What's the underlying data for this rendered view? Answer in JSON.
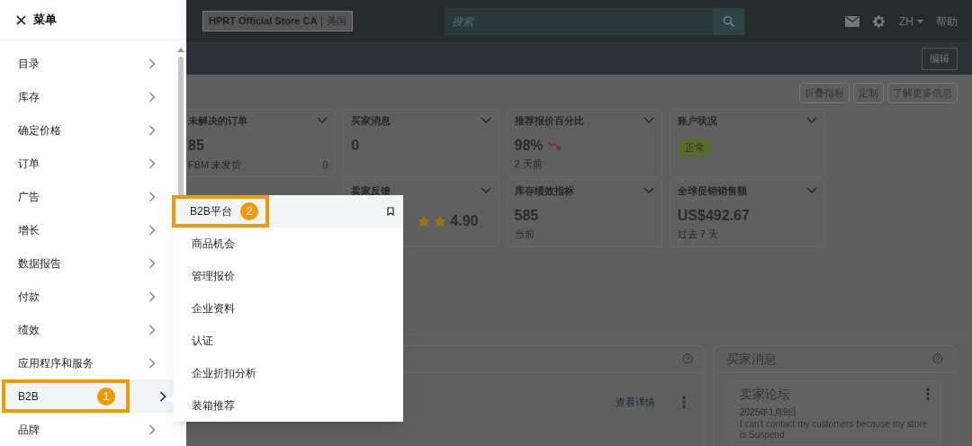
{
  "header": {
    "store": "HPRT Official Store CA",
    "region": "美国",
    "search": {
      "placeholder": "搜索"
    },
    "language": "ZH",
    "help": "帮助"
  },
  "subbar": {
    "edit": "编辑"
  },
  "toolbar": [
    "折叠指标",
    "定制",
    "了解更多信息"
  ],
  "metrics": [
    {
      "kind": "orders",
      "title": "未解决的订单",
      "value": "85",
      "sub_label": "FBM 未发货",
      "sub_value": "0"
    },
    {
      "kind": "plain",
      "title": "买家消息",
      "value": "0"
    },
    {
      "kind": "trend",
      "title": "推荐报价百分比",
      "value": "98%",
      "caption": "2 天前"
    },
    {
      "kind": "status",
      "title": "账户状况",
      "value": "正常"
    },
    {
      "kind": "rating",
      "title": "卖家反馈",
      "value": "4.90"
    },
    {
      "kind": "plain",
      "title": "库存绩效指标",
      "value": "585",
      "caption": "当前"
    },
    {
      "kind": "plain",
      "title": "全球促销销售额",
      "value": "US$492.67",
      "caption": "过去 7 天"
    }
  ],
  "panels": {
    "left": {
      "link": "查看详情"
    },
    "right": {
      "title": "买家消息",
      "card": {
        "title": "卖家论坛",
        "date": "2025年1月9日",
        "text": "I can't contact my customers because my store is Suspend"
      }
    }
  },
  "menu": {
    "title": "菜单",
    "items": [
      {
        "label": "目录",
        "selected": false
      },
      {
        "label": "库存",
        "selected": false
      },
      {
        "label": "确定价格",
        "selected": false
      },
      {
        "label": "订单",
        "selected": false
      },
      {
        "label": "广告",
        "selected": false
      },
      {
        "label": "增长",
        "selected": false
      },
      {
        "label": "数据报告",
        "selected": false
      },
      {
        "label": "付款",
        "selected": false
      },
      {
        "label": "绩效",
        "selected": false
      },
      {
        "label": "应用程序和服务",
        "selected": false
      },
      {
        "label": "B2B",
        "selected": true,
        "badge": "1"
      },
      {
        "label": "品牌",
        "selected": false
      }
    ]
  },
  "submenu": {
    "items": [
      {
        "label": "B2B平台",
        "selected": true,
        "badge": "2"
      },
      {
        "label": "商品机会",
        "selected": false
      },
      {
        "label": "管理报价",
        "selected": false
      },
      {
        "label": "企业资料",
        "selected": false
      },
      {
        "label": "认证",
        "selected": false
      },
      {
        "label": "企业折扣分析",
        "selected": false
      },
      {
        "label": "装箱推荐",
        "selected": false
      }
    ]
  }
}
